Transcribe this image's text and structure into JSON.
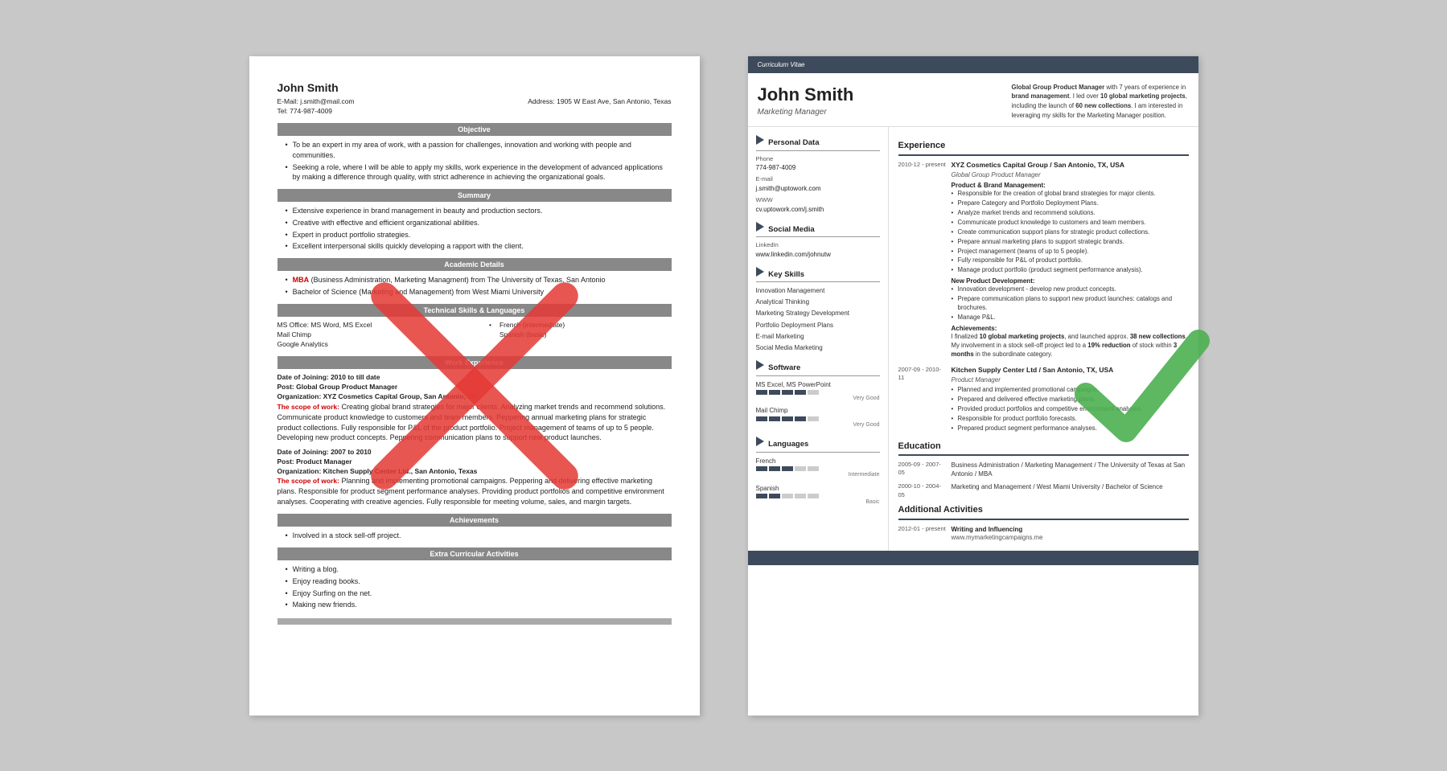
{
  "left_resume": {
    "name": "John Smith",
    "email": "E-Mail: j.smith@mail.com",
    "tel": "Tel: 774-987-4009",
    "address": "Address: 1905 W East Ave, San Antonio, Texas",
    "sections": {
      "objective": {
        "header": "Objective",
        "bullets": [
          "To be an expert in my area of work, with a passion for challenges, innovation and working with people and communities.",
          "Seeking a role, where I will be able to apply my skills, work experience in the development of advanced applications by making a difference through quality, with strict adherence in achieving the organizational goals."
        ]
      },
      "summary": {
        "header": "Summary",
        "bullets": [
          "Extensive experience in brand management in beauty and production sectors.",
          "Creative with effective and efficient organizational abilities.",
          "Expert in product portfolio strategies.",
          "Excellent interpersonal skills quickly developing a rapport with the client."
        ]
      },
      "academic": {
        "header": "Academic Details",
        "bullets": [
          "MBA (Business Administration, Marketing Managment) from The University of Texas, San Antonio",
          "Bachelor of Science (Marketing and Management) from West Miami University"
        ]
      },
      "technical": {
        "header": "Technical Skills & Languages",
        "col1": [
          "MS Office: MS Word, MS Excel",
          "Mail Chimp",
          "Google Analytics"
        ],
        "col2": [
          "French (intermediate)",
          "Spanish (basic)"
        ]
      },
      "work": {
        "header": "Work Experience",
        "jobs": [
          {
            "joining": "Date of Joining: 2010 to till date",
            "post": "Post: Global Group Product Manager",
            "org": "Organization: XYZ Cosmetics Capital Group, San Antonio, TX",
            "scope_label": "The scope of work:",
            "scope": "Creating global brand strategies for major clients. Analyzing market trends and recommend solutions. Communicate product knowledge to customers and team members. Peppering annual marketing plans for strategic product collections. Fully responsible for P&L of the product portfolio. Project management of teams of up to 5 people. Developing new product concepts. Peppering communication plans to support new product launches."
          },
          {
            "joining": "Date of Joining: 2007 to 2010",
            "post": "Post: Product Manager",
            "org": "Organization: Kitchen Supply Center Ltd., San Antonio, Texas",
            "scope_label": "The scope of work:",
            "scope": "Planning and implementing promotional campaigns. Peppering and delivering effective marketing plans. Responsible for product segment performance analyses. Providing product portfolios and competitive environment analyses. Cooperating with creative agencies. Fully responsible for meeting volume, sales, and margin targets."
          }
        ]
      },
      "achievements": {
        "header": "Achievements",
        "bullets": [
          "Involved in a stock sell-off project."
        ]
      },
      "extra": {
        "header": "Extra Curricular Activities",
        "bullets": [
          "Writing a blog.",
          "Enjoy reading books.",
          "Enjoy Surfing on the net.",
          "Making new friends."
        ]
      }
    }
  },
  "right_resume": {
    "cv_label": "Curriculum Vitae",
    "name": "John Smith",
    "title": "Marketing Manager",
    "summary": "Global Group Product Manager with 7 years of experience in brand management. I led over 10 global marketing projects, including the launch of 60 new collections. I am interested in leveraging my skills for the Marketing Manager position.",
    "personal_data": {
      "section_title": "Personal Data",
      "phone_label": "Phone",
      "phone": "774-987-4009",
      "email_label": "E-mail",
      "email": "j.smith@uptowork.com",
      "www_label": "WWW",
      "www": "cv.uptowork.com/j.smith",
      "social_title": "Social Media",
      "linkedin_label": "LinkedIn",
      "linkedin": "www.linkedin.com/johnutw"
    },
    "skills": {
      "section_title": "Key Skills",
      "items": [
        "Innovation Management",
        "Analytical Thinking",
        "Marketing Strategy Development",
        "Portfolio Deployment Plans",
        "E-mail Marketing",
        "Social Media Marketing"
      ]
    },
    "software": {
      "section_title": "Software",
      "items": [
        {
          "name": "MS Excel, MS PowerPoint",
          "level": 4,
          "label": "Very Good"
        },
        {
          "name": "Mail Chimp",
          "level": 4,
          "label": "Very Good"
        }
      ]
    },
    "languages": {
      "section_title": "Languages",
      "items": [
        {
          "name": "French",
          "level": 3,
          "label": "Intermediate"
        },
        {
          "name": "Spanish",
          "level": 2,
          "label": "Basic"
        }
      ]
    },
    "experience": {
      "section_title": "Experience",
      "items": [
        {
          "dates": "2010-12 - present",
          "company": "XYZ Cosmetics Capital Group / San Antonio, TX, USA",
          "role": "Global Group Product Manager",
          "subsections": [
            {
              "title": "Product & Brand Management:",
              "bullets": [
                "Responsible for the creation of global brand strategies for major clients.",
                "Prepare Category and Portfolio Deployment Plans.",
                "Analyze market trends and recommend solutions.",
                "Communicate product knowledge to customers and team members.",
                "Create communication support plans for strategic product collections.",
                "Prepare annual marketing plans to support strategic brands.",
                "Project management (teams of up to 5 people).",
                "Fully responsible for P&L of product portfolio.",
                "Manage product portfolio (product segment performance analysis)."
              ]
            },
            {
              "title": "New Product Development:",
              "bullets": [
                "Innovation development - develop new product concepts.",
                "Prepare communication plans to support new product launches: catalogs and brochures.",
                "Manage P&L."
              ]
            },
            {
              "title": "Achievements:",
              "text": "I finalized 10 global marketing projects, and launched approx. 38 new collections.\nMy involvement in a stock sell-off project led to a 19% reduction of stock within 3 months in the subordinate category."
            }
          ]
        },
        {
          "dates": "2007-09 - 2010-11",
          "company": "Kitchen Supply Center Ltd / San Antonio, TX, USA",
          "role": "Product Manager",
          "subsections": [
            {
              "title": "",
              "bullets": [
                "Planned and implemented promotional campaigns.",
                "Prepared and delivered effective marketing plans.",
                "Provided product portfolios and competitive environment analyses.",
                "Responsible for product portfolio forecasts.",
                "Prepared product segment performance analyses."
              ]
            }
          ]
        }
      ]
    },
    "education": {
      "section_title": "Education",
      "items": [
        {
          "dates": "2005-09 - 2007-05",
          "title": "Business Administration / Marketing Management / The University of Texas at San Antonio / MBA"
        },
        {
          "dates": "2000-10 - 2004-05",
          "title": "Marketing and Management / West Miami University / Bachelor of Science"
        }
      ]
    },
    "additional": {
      "section_title": "Additional Activities",
      "items": [
        {
          "dates": "2012-01 - present",
          "title": "Writing and Influencing",
          "link": "www.mymarketingcampaigns.me"
        }
      ]
    }
  }
}
